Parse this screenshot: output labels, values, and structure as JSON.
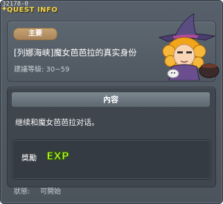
{
  "quest_id": "32178-0",
  "title": "QUEST INFO",
  "category": "主要",
  "quest_name": "[列娜海峡]魔女芭芭拉的真实身份",
  "recommended_level": "建議等級: 30~59",
  "content_header": "內容",
  "content_text": "继续和魔女芭芭拉对话。",
  "reward_label": "獎勵",
  "reward_icon": "EXP",
  "status_label": "狀態:",
  "status_value": "可開始",
  "colors": {
    "title": "#f3d451",
    "category_badge": "#b89166",
    "exp_text": "#b7ff2a"
  },
  "icons": {
    "npc_portrait": "witch-npc-icon",
    "reward": "exp-icon"
  }
}
